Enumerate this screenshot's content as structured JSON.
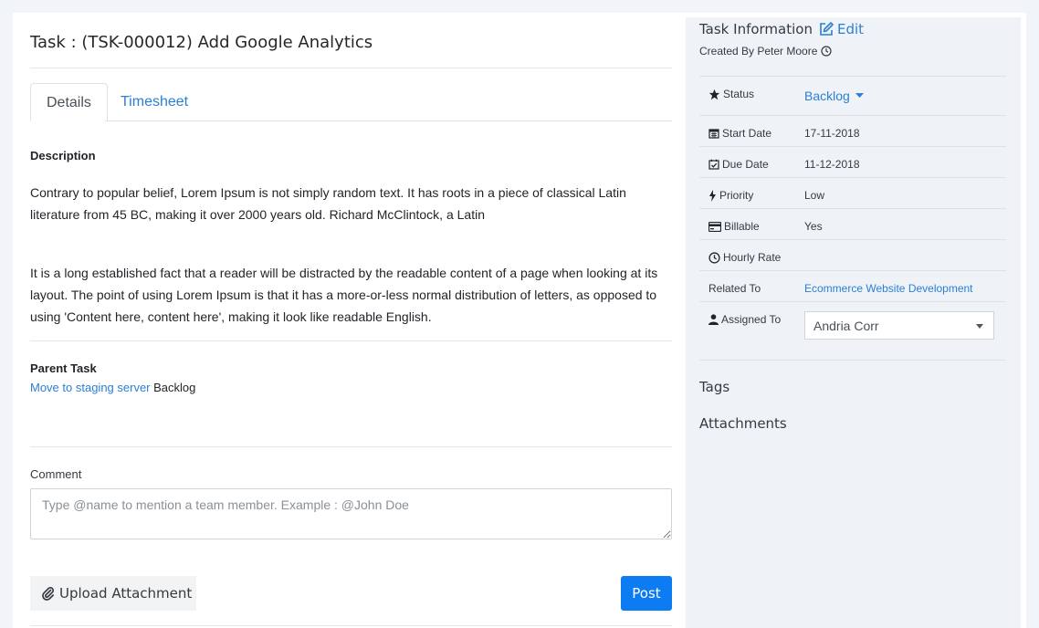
{
  "task": {
    "title": "Task : (TSK-000012) Add Google Analytics"
  },
  "tabs": [
    {
      "label": "Details",
      "active": true
    },
    {
      "label": "Timesheet",
      "active": false
    }
  ],
  "description": {
    "heading": "Description",
    "paragraph1": "Contrary to popular belief, Lorem Ipsum is not simply random text. It has roots in a piece of classical Latin literature from 45 BC, making it over 2000 years old. Richard McClintock, a Latin",
    "paragraph2": "It is a long established fact that a reader will be distracted by the readable content of a page when looking at its layout. The point of using Lorem Ipsum is that it has a more-or-less normal distribution of letters, as opposed to using 'Content here, content here', making it look like readable English."
  },
  "parent_task": {
    "heading": "Parent Task",
    "link": "Move to staging server",
    "status": "Backlog"
  },
  "comment": {
    "label": "Comment",
    "placeholder": "Type @name to mention a team member. Example : @John Doe"
  },
  "actions": {
    "upload_label": "Upload Attachment",
    "post_label": "Post"
  },
  "sidebar": {
    "title": "Task Information",
    "edit_label": "Edit",
    "created_by": "Created By Peter Moore",
    "fields": {
      "status": {
        "label": "Status",
        "value": "Backlog"
      },
      "start_date": {
        "label": "Start Date",
        "value": "17-11-2018"
      },
      "due_date": {
        "label": "Due Date",
        "value": "11-12-2018"
      },
      "priority": {
        "label": "Priority",
        "value": "Low"
      },
      "billable": {
        "label": "Billable",
        "value": "Yes"
      },
      "hourly_rate": {
        "label": "Hourly Rate",
        "value": ""
      },
      "related_to": {
        "label": "Related To",
        "value": "Ecommerce Website Development"
      },
      "assigned_to": {
        "label": "Assigned To",
        "value": "Andria Corr"
      }
    },
    "tags_label": "Tags",
    "attachments_label": "Attachments"
  },
  "colors": {
    "link": "#2a7fd4",
    "primary_button": "#0d7cf2",
    "sidebar_bg": "#eff3f7",
    "page_bg": "#f1f4f8"
  }
}
